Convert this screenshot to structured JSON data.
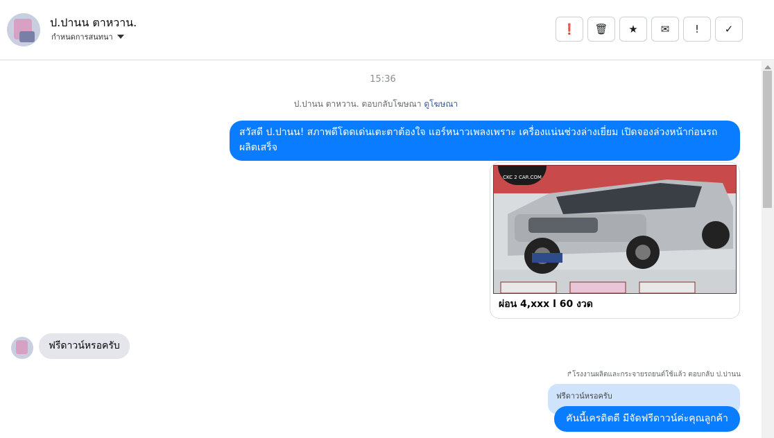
{
  "header": {
    "name": "ป.ปานน ตาหวาน.",
    "subtitle": "กำหนดการสนทนา",
    "actions": [
      {
        "icon": "alert-circle-icon",
        "glyph": "❗"
      },
      {
        "icon": "trash-icon",
        "glyph": "🗑"
      },
      {
        "icon": "star-icon",
        "glyph": "★"
      },
      {
        "icon": "envelope-icon",
        "glyph": "✉"
      },
      {
        "icon": "exclamation-icon",
        "glyph": "!"
      },
      {
        "icon": "check-icon",
        "glyph": "✓"
      }
    ]
  },
  "conversation": {
    "time": "15:36",
    "ad_reply_text": "ป.ปานน ตาหวาน. ตอบกลับโฆษณา",
    "ad_reply_link": "ดูโฆษณา",
    "outgoing_message": "สวัสดี ป.ปานน! สภาพดีโดดเด่นเตะตาต้องใจ แอร์หนาวเพลงเพราะ เครื่องแน่นช่วงล่างเยี่ยม เปิดจองล่วงหน้าก่อนรถผลิตเสร็จ",
    "card": {
      "logo_text": "CKC 2 CAR.COM",
      "title": "ผ่อน 4,xxx l 60 งวด"
    },
    "incoming_message": "ฟรีดาวน์หรอครับ",
    "reply_label": "↱โรงงานผลิตและกระจายรถยนต์ใช้แล้ว ตอบกลับ ป.ปานน",
    "quoted_text": "ฟรีดาวน์หรอครับ",
    "reply_message": "คันนี้เครดิตดี มีจัดฟรีดาวน์ค่ะคุณลูกค้า"
  },
  "colors": {
    "accent": "#0a7cff",
    "incoming_bubble": "#e4e6eb",
    "quoted_bubble": "#cfe3fd"
  }
}
